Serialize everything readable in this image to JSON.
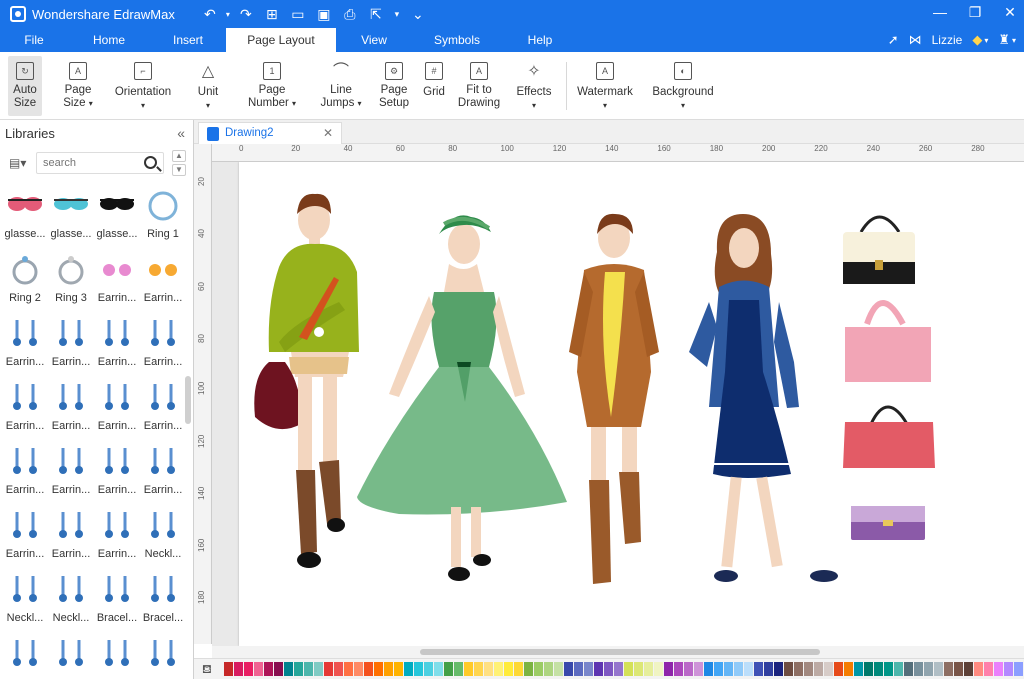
{
  "app": {
    "title": "Wondershare EdrawMax"
  },
  "quick_access": [
    "undo-icon",
    "redo-icon",
    "new-icon",
    "open-icon",
    "save-icon",
    "print-icon",
    "export-icon",
    "more-icon"
  ],
  "menu": {
    "tabs": [
      "File",
      "Home",
      "Insert",
      "Page Layout",
      "View",
      "Symbols",
      "Help"
    ],
    "active": "Page Layout",
    "user": "Lizzie"
  },
  "ribbon": {
    "auto_size": [
      "Auto",
      "Size"
    ],
    "page_size": [
      "Page",
      "Size"
    ],
    "orientation": "Orientation",
    "unit": "Unit",
    "page_number": [
      "Page",
      "Number"
    ],
    "line_jumps": [
      "Line",
      "Jumps"
    ],
    "page_setup": [
      "Page",
      "Setup"
    ],
    "grid": "Grid",
    "fit_to_drawing": [
      "Fit to",
      "Drawing"
    ],
    "effects": "Effects",
    "watermark": "Watermark",
    "background": "Background"
  },
  "libraries": {
    "title": "Libraries",
    "search_placeholder": "search",
    "items": [
      "glasse...",
      "glasse...",
      "glasse...",
      "Ring 1",
      "Ring 2",
      "Ring 3",
      "Earrin...",
      "Earrin...",
      "Earrin...",
      "Earrin...",
      "Earrin...",
      "Earrin...",
      "Earrin...",
      "Earrin...",
      "Earrin...",
      "Earrin...",
      "Earrin...",
      "Earrin...",
      "Earrin...",
      "Earrin...",
      "Earrin...",
      "Earrin...",
      "Earrin...",
      "Neckl...",
      "Neckl...",
      "Neckl...",
      "Bracel...",
      "Bracel...",
      "",
      "",
      "",
      ""
    ]
  },
  "document": {
    "tab": "Drawing2"
  },
  "ruler": {
    "h": [
      "0",
      "20",
      "40",
      "60",
      "80",
      "100",
      "120",
      "140",
      "160",
      "180",
      "200",
      "220",
      "240",
      "260",
      "280"
    ],
    "v": [
      "20",
      "40",
      "60",
      "80",
      "100",
      "120",
      "140",
      "160",
      "180"
    ]
  },
  "palette": [
    "#c62828",
    "#d81b60",
    "#e91e63",
    "#f06292",
    "#ad1457",
    "#880e4f",
    "#00838f",
    "#26a69a",
    "#4db6ac",
    "#80cbc4",
    "#e53935",
    "#ef5350",
    "#ff7043",
    "#ff8a65",
    "#f4511e",
    "#ff6f00",
    "#ffa000",
    "#ffb300",
    "#00acc1",
    "#26c6da",
    "#4dd0e1",
    "#80deea",
    "#43a047",
    "#66bb6a",
    "#ffca28",
    "#ffd54f",
    "#ffe082",
    "#fff176",
    "#ffeb3b",
    "#fdd835",
    "#7cb342",
    "#9ccc65",
    "#aed581",
    "#c5e1a5",
    "#3949ab",
    "#5c6bc0",
    "#7986cb",
    "#5e35b1",
    "#7e57c2",
    "#9575cd",
    "#d4e157",
    "#dce775",
    "#e6ee9c",
    "#f0f4c3",
    "#8e24aa",
    "#ab47bc",
    "#ba68c8",
    "#ce93d8",
    "#1e88e5",
    "#42a5f5",
    "#64b5f6",
    "#90caf9",
    "#bbdefb",
    "#3f51b5",
    "#303f9f",
    "#1a237e",
    "#6d4c41",
    "#8d6e63",
    "#a1887f",
    "#bcaaa4",
    "#d7ccc8",
    "#e64a19",
    "#f57c00",
    "#0097a7",
    "#00796b",
    "#00897b",
    "#009688",
    "#4db6ac",
    "#546e7a",
    "#78909c",
    "#90a4ae",
    "#b0bec5",
    "#8d6e63",
    "#795548",
    "#5d4037",
    "#ff8a80",
    "#ff80ab",
    "#ea80fc",
    "#b388ff",
    "#8c9eff",
    "#bdbdbd",
    "#9e9e9e",
    "#757575",
    "#616161",
    "#424242",
    "#212121",
    "#000000",
    "#ffffff",
    "#eeeeee",
    "#e0e0e0"
  ]
}
